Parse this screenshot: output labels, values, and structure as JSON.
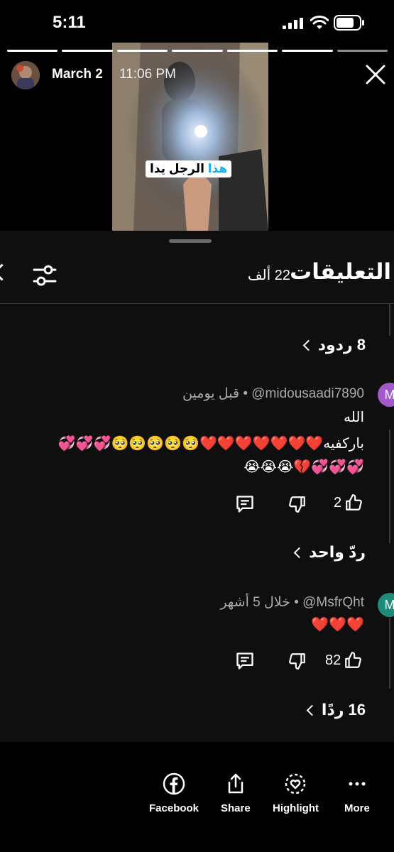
{
  "status_bar": {
    "time": "5:11"
  },
  "story": {
    "user": "March 2",
    "time": "11:06 PM",
    "caption_highlight": "هذا",
    "caption_rest": "الرجل يدا",
    "progress_segments": 7,
    "active_segments": 6
  },
  "comments_sheet": {
    "title": "التعليقات",
    "count": "22 ألف",
    "top_replies_link": "8 ردود",
    "comments": [
      {
        "avatar_letter": "M",
        "avatar_color": "#a259c9",
        "handle": "@midousaadi7890",
        "time": "قبل يومين",
        "lines": [
          "الله",
          "باركفيه❤️❤️❤️❤️❤️❤️❤️🥺🥺🥺🥺🥺💞💞💞",
          "💞💞💞💔😭😭😭"
        ],
        "likes": "2",
        "replies_link": "ردّ واحد"
      },
      {
        "avatar_letter": "M",
        "avatar_color": "#1e8a7a",
        "handle": "@MsfrQht",
        "time": "خلال 5 أشهر",
        "lines": [
          "❤️❤️❤️"
        ],
        "likes": "82",
        "replies_link": "16 ردًا"
      }
    ]
  },
  "bottom_bar": {
    "facebook": "Facebook",
    "share": "Share",
    "highlight": "Highlight",
    "more": "More"
  }
}
